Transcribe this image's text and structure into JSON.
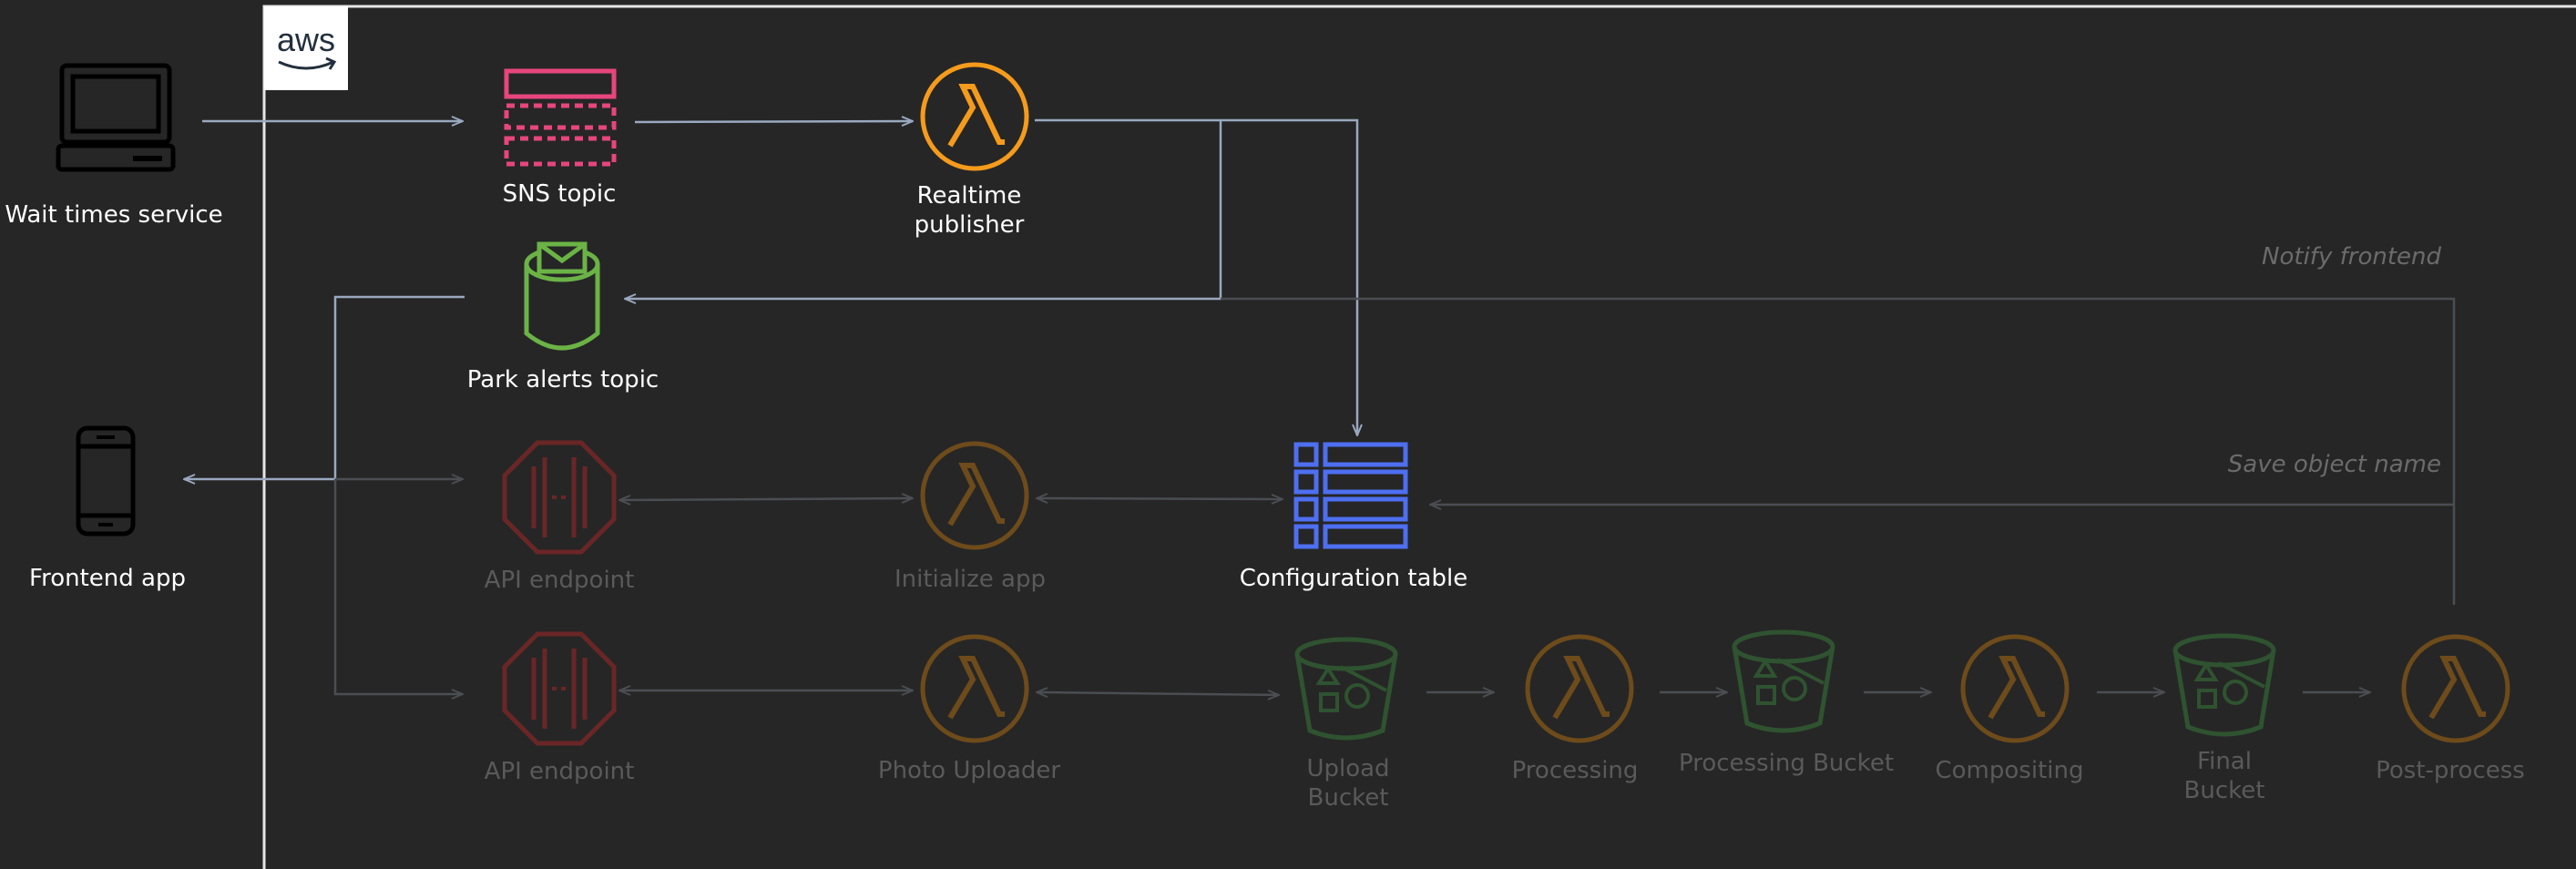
{
  "diagram": {
    "aws_logo": "aws",
    "colors": {
      "background": "#262626",
      "sns": "#e7457d",
      "lambda": "#f59b1c",
      "sqs": "#6bb346",
      "dynamodb": "#4d6ff0",
      "api_dim": "#6a2626",
      "lambda_dim": "#6e4b1b",
      "s3_dim": "#2f5330",
      "active_arrow": "#9aa8c0",
      "dim_arrow": "#4a4d52"
    },
    "nodes": {
      "wait_times_service": {
        "label": "Wait times service",
        "icon": "laptop-icon"
      },
      "sns_topic": {
        "label": "SNS topic",
        "icon": "sns-topic-icon"
      },
      "realtime_publisher": {
        "label": "Realtime publisher",
        "icon": "lambda-icon"
      },
      "park_alerts_topic": {
        "label": "Park alerts topic",
        "icon": "sns-mailbox-icon"
      },
      "frontend_app": {
        "label": "Frontend app",
        "icon": "mobile-phone-icon"
      },
      "api_endpoint_1": {
        "label": "API endpoint",
        "icon": "api-gateway-icon"
      },
      "initialize_app": {
        "label": "Initialize app",
        "icon": "lambda-icon"
      },
      "configuration_table": {
        "label": "Configuration table",
        "icon": "dynamodb-table-icon"
      },
      "api_endpoint_2": {
        "label": "API endpoint",
        "icon": "api-gateway-icon"
      },
      "photo_uploader": {
        "label": "Photo Uploader",
        "icon": "lambda-icon"
      },
      "upload_bucket": {
        "label": "Upload Bucket",
        "icon": "s3-bucket-icon"
      },
      "processing": {
        "label": "Processing",
        "icon": "lambda-icon"
      },
      "processing_bucket": {
        "label": "Processing Bucket",
        "icon": "s3-bucket-icon"
      },
      "compositing": {
        "label": "Compositing",
        "icon": "lambda-icon"
      },
      "final_bucket": {
        "label": "Final Bucket",
        "icon": "s3-bucket-icon"
      },
      "post_process": {
        "label": "Post-process",
        "icon": "lambda-icon"
      }
    },
    "annotations": {
      "notify_frontend": "Notify frontend",
      "save_object_name": "Save object name"
    }
  }
}
